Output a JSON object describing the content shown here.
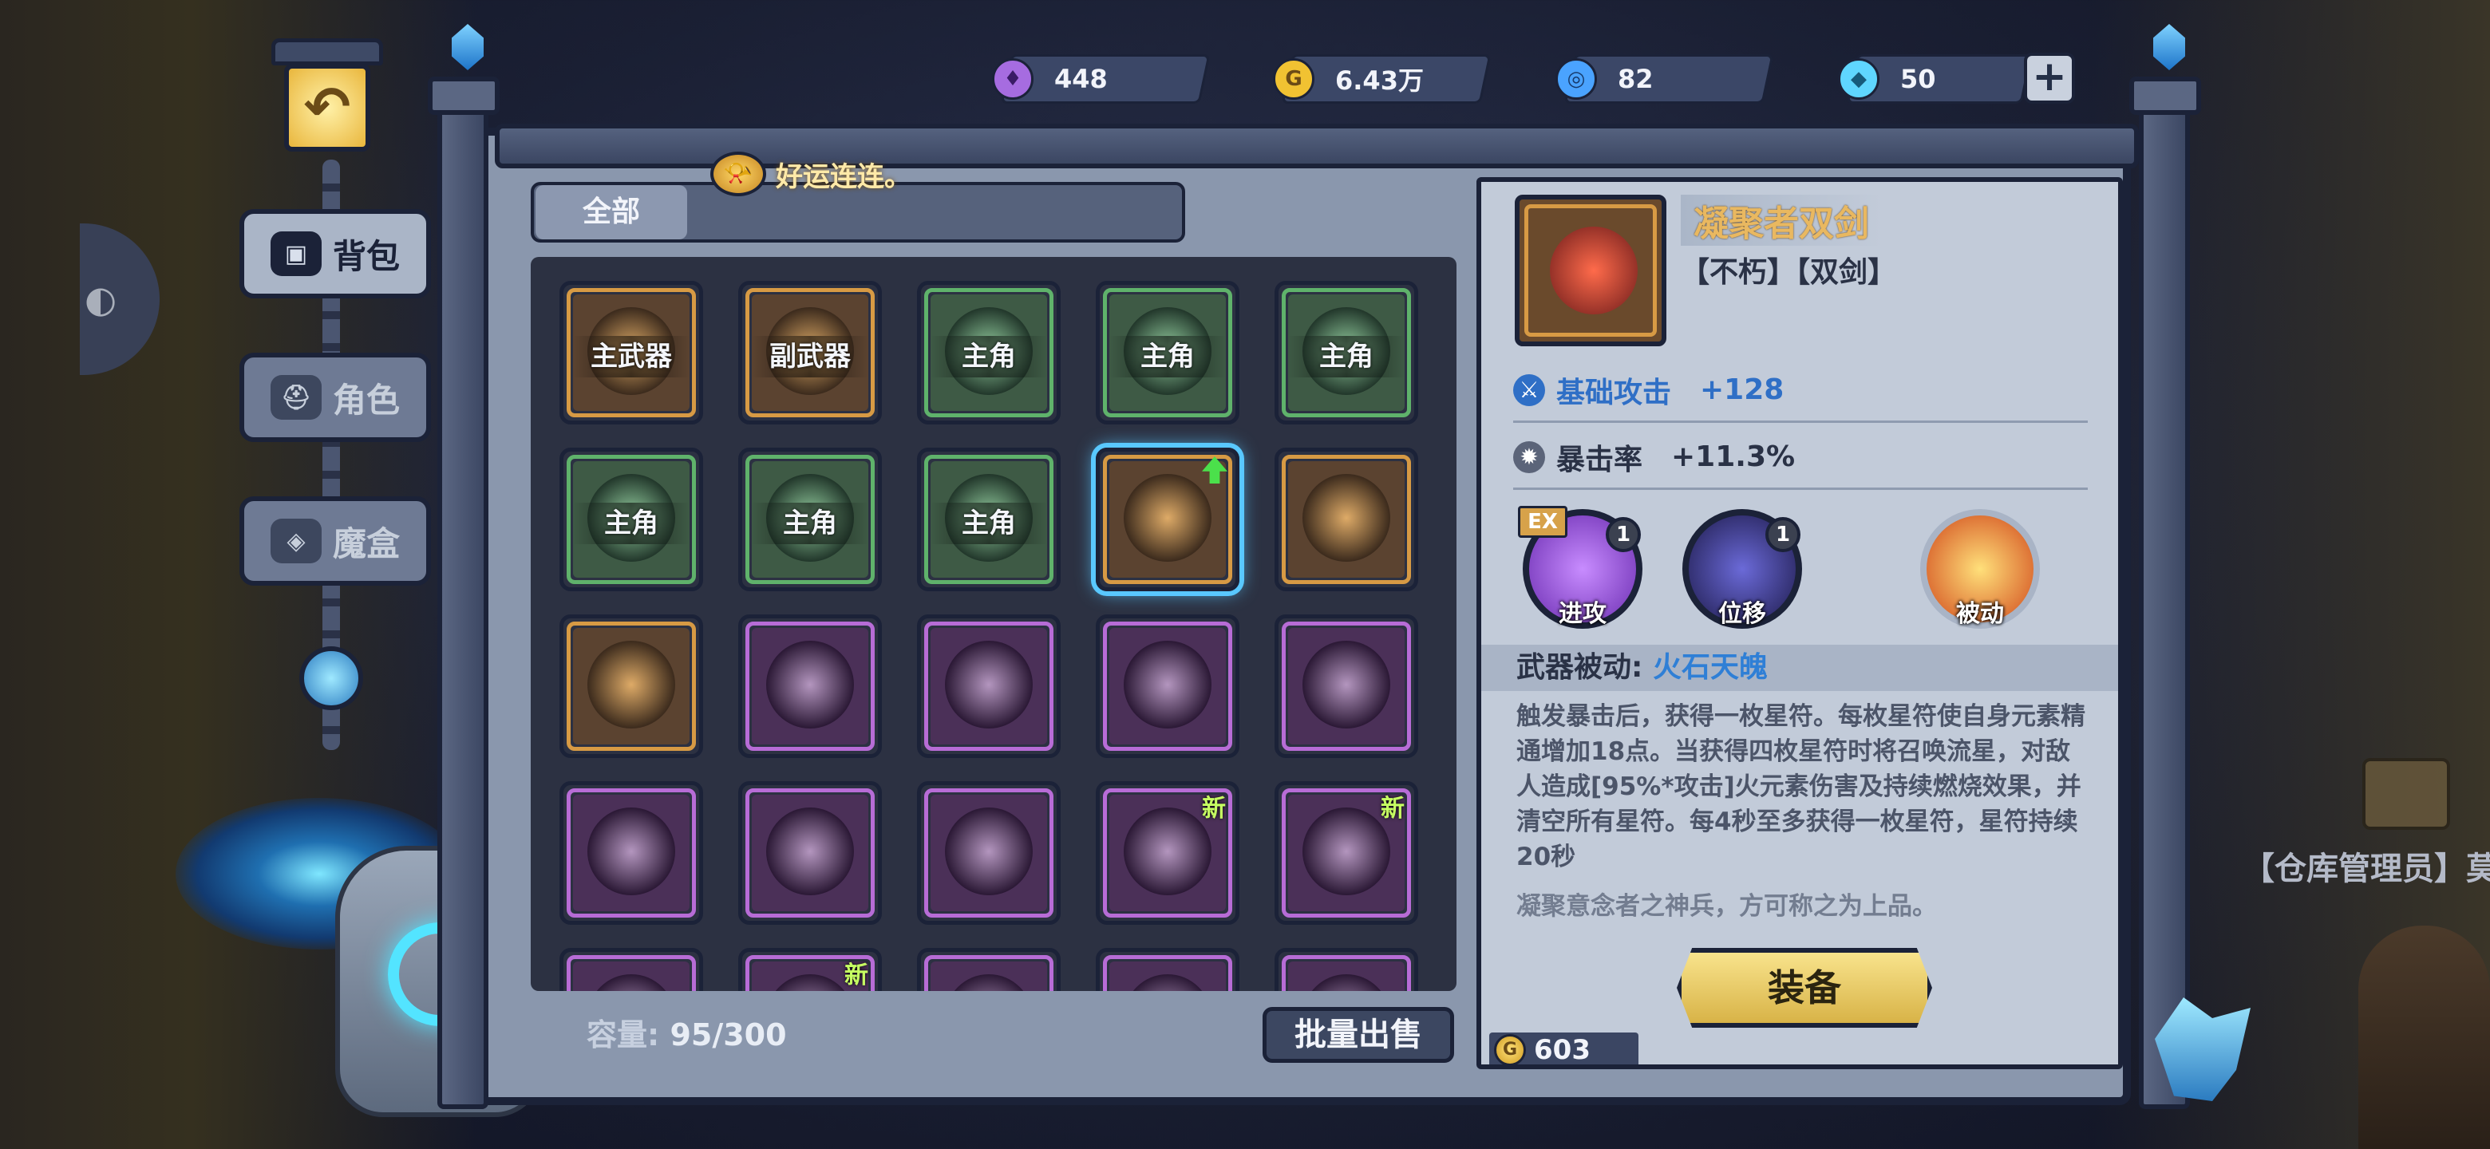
{
  "resources": [
    {
      "name": "purple-token",
      "value": "448",
      "icon_color": "#a66ce0"
    },
    {
      "name": "gold",
      "value": "6.43万",
      "icon_color": "#f1c232"
    },
    {
      "name": "blue-token",
      "value": "82",
      "icon_color": "#4aa3ff"
    },
    {
      "name": "diamond",
      "value": "50",
      "icon_color": "#5fd6ff"
    }
  ],
  "plus_label": "+",
  "side_nav": [
    {
      "label": "背包",
      "active": true,
      "icon": "backpack-icon"
    },
    {
      "label": "角色",
      "active": false,
      "icon": "helmet-icon"
    },
    {
      "label": "魔盒",
      "active": false,
      "icon": "magic-box-icon"
    }
  ],
  "toast_text": "好运连连。",
  "tabs": [
    {
      "label": "全部",
      "active": true
    }
  ],
  "items": [
    {
      "label": "主武器",
      "rarity": "orange",
      "selected": false,
      "new": false
    },
    {
      "label": "副武器",
      "rarity": "orange",
      "selected": false,
      "new": false
    },
    {
      "label": "主角",
      "rarity": "green",
      "selected": false,
      "new": false
    },
    {
      "label": "主角",
      "rarity": "green",
      "selected": false,
      "new": false
    },
    {
      "label": "主角",
      "rarity": "green",
      "selected": false,
      "new": false
    },
    {
      "label": "主角",
      "rarity": "green",
      "selected": false,
      "new": false
    },
    {
      "label": "主角",
      "rarity": "green",
      "selected": false,
      "new": false
    },
    {
      "label": "主角",
      "rarity": "green",
      "selected": false,
      "new": false
    },
    {
      "label": "",
      "rarity": "orange",
      "selected": true,
      "new": false,
      "upgrade": true
    },
    {
      "label": "",
      "rarity": "orange",
      "selected": false,
      "new": false
    },
    {
      "label": "",
      "rarity": "orange",
      "selected": false,
      "new": false
    },
    {
      "label": "",
      "rarity": "purple",
      "selected": false,
      "new": false
    },
    {
      "label": "",
      "rarity": "purple",
      "selected": false,
      "new": false
    },
    {
      "label": "",
      "rarity": "purple",
      "selected": false,
      "new": false
    },
    {
      "label": "",
      "rarity": "purple",
      "selected": false,
      "new": false
    },
    {
      "label": "",
      "rarity": "purple",
      "selected": false,
      "new": false
    },
    {
      "label": "",
      "rarity": "purple",
      "selected": false,
      "new": false
    },
    {
      "label": "",
      "rarity": "purple",
      "selected": false,
      "new": false
    },
    {
      "label": "",
      "rarity": "purple",
      "selected": false,
      "new": true
    },
    {
      "label": "",
      "rarity": "purple",
      "selected": false,
      "new": true
    },
    {
      "label": "",
      "rarity": "purple",
      "selected": false,
      "new": false
    },
    {
      "label": "",
      "rarity": "purple",
      "selected": false,
      "new": true
    },
    {
      "label": "",
      "rarity": "purple",
      "selected": false,
      "new": false
    },
    {
      "label": "",
      "rarity": "purple",
      "selected": false,
      "new": false
    },
    {
      "label": "",
      "rarity": "purple",
      "selected": false,
      "new": false
    }
  ],
  "new_tag": "新",
  "capacity_label": "容量:",
  "capacity_value": "95/300",
  "batch_sell_label": "批量出售",
  "detail": {
    "name": "凝聚者双剑",
    "tags": "【不朽】【双剑】",
    "stats": [
      {
        "label": "基础攻击",
        "value": "+128",
        "color": "#2f6fc6",
        "icon": "sword-icon"
      },
      {
        "label": "暴击率",
        "value": "+11.3%",
        "color": "#2a3246",
        "icon": "crit-icon"
      }
    ],
    "skills": [
      {
        "label": "进攻",
        "level": "1",
        "ex": true
      },
      {
        "label": "位移",
        "level": "1",
        "ex": false
      },
      {
        "label": "被动",
        "level": "",
        "ex": false
      }
    ],
    "ex_label": "EX",
    "passive_label": "武器被动:",
    "passive_name": "火石天魄",
    "description": "触发暴击后，获得一枚星符。每枚星符使自身元素精通增加18点。当获得四枚星符时将召唤流星，对敌人造成[95%*攻击]火元素伤害及持续燃烧效果，并清空所有星符。每4秒至多获得一枚星符，星符持续20秒",
    "flavor": "凝聚意念者之神兵，方可称之为上品。",
    "equip_label": "装备",
    "gold_cost": "603"
  },
  "npc_label": "【仓库管理员】莫"
}
